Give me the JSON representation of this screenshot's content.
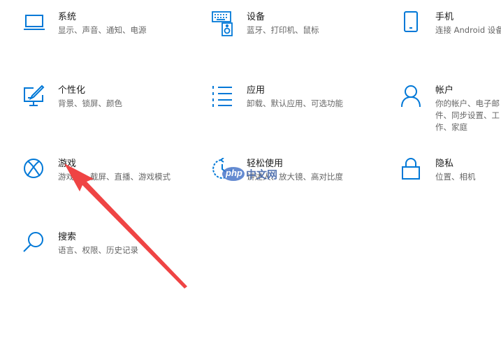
{
  "accent_color": "#0078d7",
  "annotation_arrow_color": "#ef4444",
  "tiles": {
    "system": {
      "title": "系统",
      "desc": "显示、声音、通知、电源",
      "icon": "laptop-icon"
    },
    "devices": {
      "title": "设备",
      "desc": "蓝牙、打印机、鼠标",
      "icon": "keyboard-speaker-icon"
    },
    "phone": {
      "title": "手机",
      "desc": "连接 Android 设备",
      "icon": "phone-icon"
    },
    "personalization": {
      "title": "个性化",
      "desc": "背景、锁屏、颜色",
      "icon": "paint-monitor-icon"
    },
    "apps": {
      "title": "应用",
      "desc": "卸载、默认应用、可选功能",
      "icon": "list-icon"
    },
    "accounts": {
      "title": "帐户",
      "desc": "你的帐户、电子邮件、同步设置、工作、家庭",
      "icon": "person-icon"
    },
    "gaming": {
      "title": "游戏",
      "desc": "游戏栏、截屏、直播、游戏模式",
      "icon": "xbox-icon"
    },
    "ease": {
      "title": "轻松使用",
      "desc": "讲述人、放大镜、高对比度",
      "icon": "ease-of-access-icon"
    },
    "privacy": {
      "title": "隐私",
      "desc": "位置、相机",
      "icon": "lock-icon"
    },
    "search": {
      "title": "搜索",
      "desc": "语言、权限、历史记录",
      "icon": "search-icon"
    }
  },
  "watermark": {
    "logo": "php",
    "text": "中文网"
  }
}
